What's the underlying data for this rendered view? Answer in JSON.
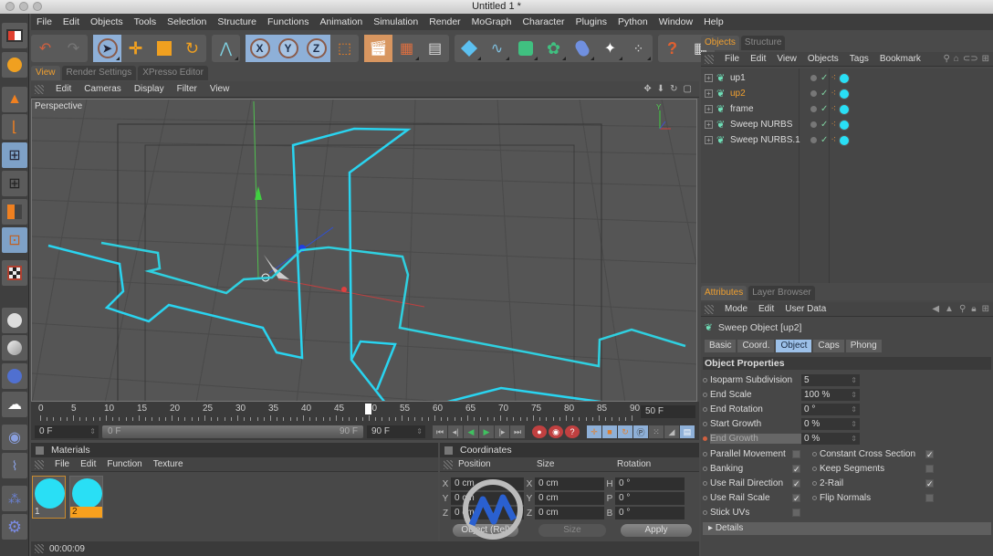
{
  "window": {
    "title": "Untitled 1 *"
  },
  "menu": [
    "File",
    "Edit",
    "Objects",
    "Tools",
    "Selection",
    "Structure",
    "Functions",
    "Animation",
    "Simulation",
    "Render",
    "MoGraph",
    "Character",
    "Plugins",
    "Python",
    "Window",
    "Help"
  ],
  "toolbar": {
    "groups": [
      [
        "undo-icon",
        "redo-icon"
      ],
      [
        "live-selection-icon",
        "move-icon",
        "scale-icon",
        "rotate-icon"
      ],
      [
        "polygon-pen-icon"
      ],
      [
        "x-axis-lock",
        "y-axis-lock",
        "z-axis-lock",
        "coordinate-system-icon"
      ],
      [
        "render-view-icon",
        "render-picture-viewer-icon",
        "render-settings-icon"
      ],
      [
        "cube-primitive-icon",
        "spline-pen-icon",
        "nurbs-icon",
        "array-icon",
        "deformer-bend-icon",
        "scene-icon",
        "particle-emitter-icon"
      ],
      [
        "help-icon",
        "timeline-icon"
      ]
    ],
    "axis_labels": [
      "X",
      "Y",
      "Z"
    ]
  },
  "viewport": {
    "tabs": [
      {
        "label": "View",
        "active": true
      },
      {
        "label": "Render Settings",
        "active": false
      },
      {
        "label": "XPresso Editor",
        "active": false
      }
    ],
    "menu": [
      "Edit",
      "Cameras",
      "Display",
      "Filter",
      "View"
    ],
    "camera_label": "Perspective",
    "axis_label": "Y"
  },
  "timeline": {
    "ticks": [
      "0",
      "5",
      "10",
      "15",
      "20",
      "25",
      "30",
      "35",
      "40",
      "45",
      "50",
      "55",
      "60",
      "65",
      "70",
      "75",
      "80",
      "85",
      "90"
    ],
    "current_frame": "50 F",
    "start_field": "0 F",
    "range_start": "0 F",
    "range_end": "90 F",
    "end_field": "90 F",
    "playhead_frame": 50,
    "max_frame": 90
  },
  "materials": {
    "title": "Materials",
    "menu": [
      "File",
      "Edit",
      "Function",
      "Texture"
    ],
    "items": [
      {
        "label": "1",
        "color": "#29dff5"
      },
      {
        "label": "2",
        "color": "#29dff5"
      }
    ]
  },
  "status": {
    "time": "00:00:09"
  },
  "coordinates": {
    "title": "Coordinates",
    "headers": [
      "Position",
      "Size",
      "Rotation"
    ],
    "rows": [
      {
        "pos_axis": "X",
        "pos": "0 cm",
        "size_axis": "X",
        "size": "0 cm",
        "rot_axis": "H",
        "rot": "0 °"
      },
      {
        "pos_axis": "Y",
        "pos": "0 cm",
        "size_axis": "Y",
        "size": "0 cm",
        "rot_axis": "P",
        "rot": "0 °"
      },
      {
        "pos_axis": "Z",
        "pos": "0 cm",
        "size_axis": "Z",
        "size": "0 cm",
        "rot_axis": "B",
        "rot": "0 °"
      }
    ],
    "mode_select": "Object (Rel)",
    "size_select": "Size",
    "apply_label": "Apply"
  },
  "objects_panel": {
    "tabs": [
      {
        "label": "Objects",
        "active": true
      },
      {
        "label": "Structure",
        "active": false
      }
    ],
    "menu": [
      "File",
      "Edit",
      "View",
      "Objects",
      "Tags",
      "Bookmark"
    ],
    "items": [
      {
        "name": "up1",
        "selected": false
      },
      {
        "name": "up2",
        "selected": true
      },
      {
        "name": "frame",
        "selected": false
      },
      {
        "name": "Sweep NURBS",
        "selected": false
      },
      {
        "name": "Sweep NURBS.1",
        "selected": false
      }
    ]
  },
  "attributes": {
    "tabs": [
      {
        "label": "Attributes",
        "active": true
      },
      {
        "label": "Layer Browser",
        "active": false
      }
    ],
    "menu": [
      "Mode",
      "Edit",
      "User Data"
    ],
    "object_title": "Sweep Object [up2]",
    "subtabs": [
      {
        "label": "Basic",
        "active": false
      },
      {
        "label": "Coord.",
        "active": false
      },
      {
        "label": "Object",
        "active": true
      },
      {
        "label": "Caps",
        "active": false
      },
      {
        "label": "Phong",
        "active": false
      }
    ],
    "section": "Object Properties",
    "fields": [
      {
        "label": "Isoparm Subdivision",
        "value": "5"
      },
      {
        "label": "End Scale",
        "value": "100 %"
      },
      {
        "label": "End Rotation",
        "value": "0 °"
      },
      {
        "label": "Start Growth",
        "value": "0 %"
      },
      {
        "label": "End Growth",
        "value": "0 %"
      }
    ],
    "checks_left": [
      {
        "label": "Parallel Movement",
        "checked": false
      },
      {
        "label": "Banking",
        "checked": true
      },
      {
        "label": "Use Rail Direction",
        "checked": true
      },
      {
        "label": "Use Rail Scale",
        "checked": true
      },
      {
        "label": "Stick UVs",
        "checked": false
      }
    ],
    "checks_right": [
      {
        "label": "Constant Cross Section",
        "checked": true
      },
      {
        "label": "Keep Segments",
        "checked": false
      },
      {
        "label": "2-Rail",
        "checked": true
      },
      {
        "label": "Flip Normals",
        "checked": false
      }
    ],
    "details_label": "Details"
  },
  "colors": {
    "accent": "#f0a030",
    "spline": "#29d4f0",
    "selection": "#8eb0d8"
  }
}
